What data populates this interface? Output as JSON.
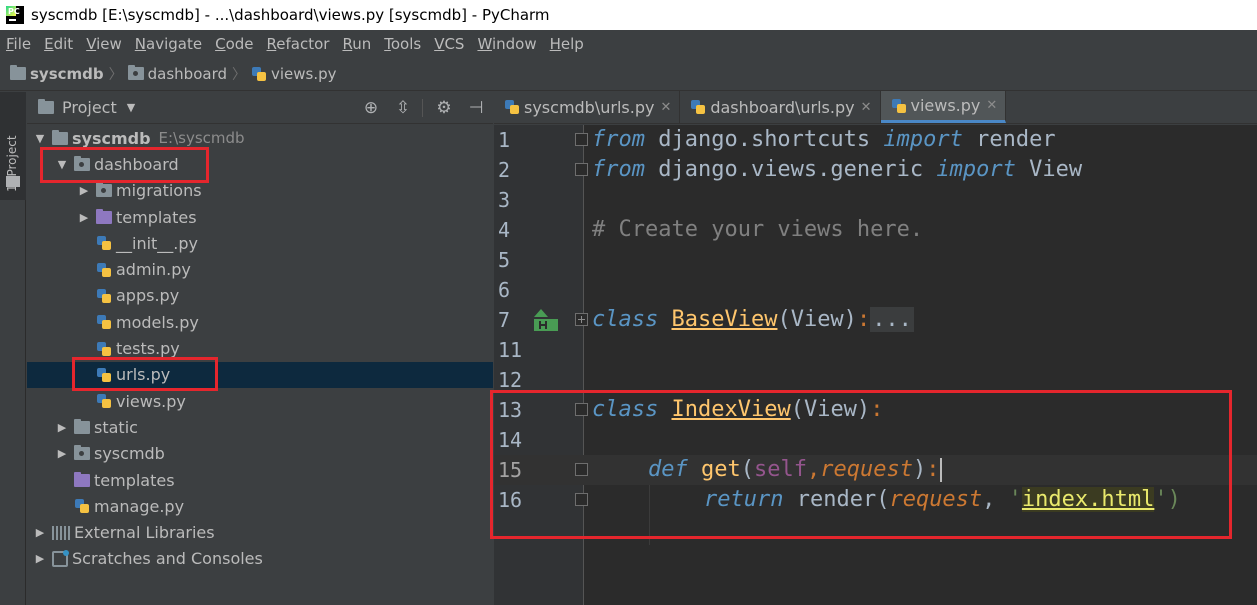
{
  "window": {
    "title": "syscmdb [E:\\syscmdb] - ...\\dashboard\\views.py [syscmdb] - PyCharm",
    "logo_text": "PC"
  },
  "menu": [
    "File",
    "Edit",
    "View",
    "Navigate",
    "Code",
    "Refactor",
    "Run",
    "Tools",
    "VCS",
    "Window",
    "Help"
  ],
  "breadcrumb": [
    "syscmdb",
    "dashboard",
    "views.py"
  ],
  "toolwindow": {
    "side_tab": "1: Project"
  },
  "project_panel": {
    "title": "Project",
    "tree": [
      {
        "label": "syscmdb",
        "path": "E:\\syscmdb",
        "depth": 0,
        "expanded": true,
        "icon": "folder-icon"
      },
      {
        "label": "dashboard",
        "depth": 1,
        "expanded": true,
        "icon": "package-folder-icon",
        "highlight": true
      },
      {
        "label": "migrations",
        "depth": 2,
        "expanded": false,
        "icon": "package-folder-icon"
      },
      {
        "label": "templates",
        "depth": 2,
        "expanded": false,
        "icon": "templates-folder-icon"
      },
      {
        "label": "__init__.py",
        "depth": 2,
        "icon": "python-file-icon"
      },
      {
        "label": "admin.py",
        "depth": 2,
        "icon": "python-file-icon"
      },
      {
        "label": "apps.py",
        "depth": 2,
        "icon": "python-file-icon"
      },
      {
        "label": "models.py",
        "depth": 2,
        "icon": "python-file-icon"
      },
      {
        "label": "tests.py",
        "depth": 2,
        "icon": "python-file-icon"
      },
      {
        "label": "urls.py",
        "depth": 2,
        "icon": "python-file-icon",
        "selected": true,
        "highlight": true
      },
      {
        "label": "views.py",
        "depth": 2,
        "icon": "python-file-icon"
      },
      {
        "label": "static",
        "depth": 1,
        "expanded": false,
        "icon": "folder-icon"
      },
      {
        "label": "syscmdb",
        "depth": 1,
        "expanded": false,
        "icon": "package-folder-icon"
      },
      {
        "label": "templates",
        "depth": 1,
        "icon": "templates-folder-icon"
      },
      {
        "label": "manage.py",
        "depth": 1,
        "icon": "python-file-icon"
      },
      {
        "label": "External Libraries",
        "depth": 0,
        "expanded": false,
        "icon": "library-icon"
      },
      {
        "label": "Scratches and Consoles",
        "depth": 0,
        "expanded": false,
        "icon": "scratches-icon"
      }
    ]
  },
  "editor": {
    "tabs": [
      {
        "label": "syscmdb\\urls.py",
        "active": false
      },
      {
        "label": "dashboard\\urls.py",
        "active": false
      },
      {
        "label": "views.py",
        "active": true
      }
    ],
    "current_line": "15",
    "lines": [
      {
        "n": "1"
      },
      {
        "n": "2"
      },
      {
        "n": "3"
      },
      {
        "n": "4"
      },
      {
        "n": "5"
      },
      {
        "n": "6"
      },
      {
        "n": "7"
      },
      {
        "n": "11"
      },
      {
        "n": "12"
      },
      {
        "n": "13"
      },
      {
        "n": "14"
      },
      {
        "n": "15"
      },
      {
        "n": "16"
      }
    ]
  },
  "code_tokens": {
    "from": "from",
    "import": "import",
    "mod1": " django.shortcuts ",
    "render": " render",
    "mod2": " django.views.generic ",
    "view": " View",
    "comment": "# Create your views here.",
    "class": "class",
    "baseview": "BaseView",
    "paren_view": "(View)",
    "colon": ":",
    "folded": "...",
    "indexview": "IndexView",
    "def": "def",
    "get": "get",
    "lparen": "(",
    "self": "self",
    "comma": ",",
    "request": "request",
    "rparen": ")",
    "return": "return",
    "render_call": "render(",
    "comma_space": ", ",
    "quote": "'",
    "index_html": "index.html",
    "close": "')"
  }
}
